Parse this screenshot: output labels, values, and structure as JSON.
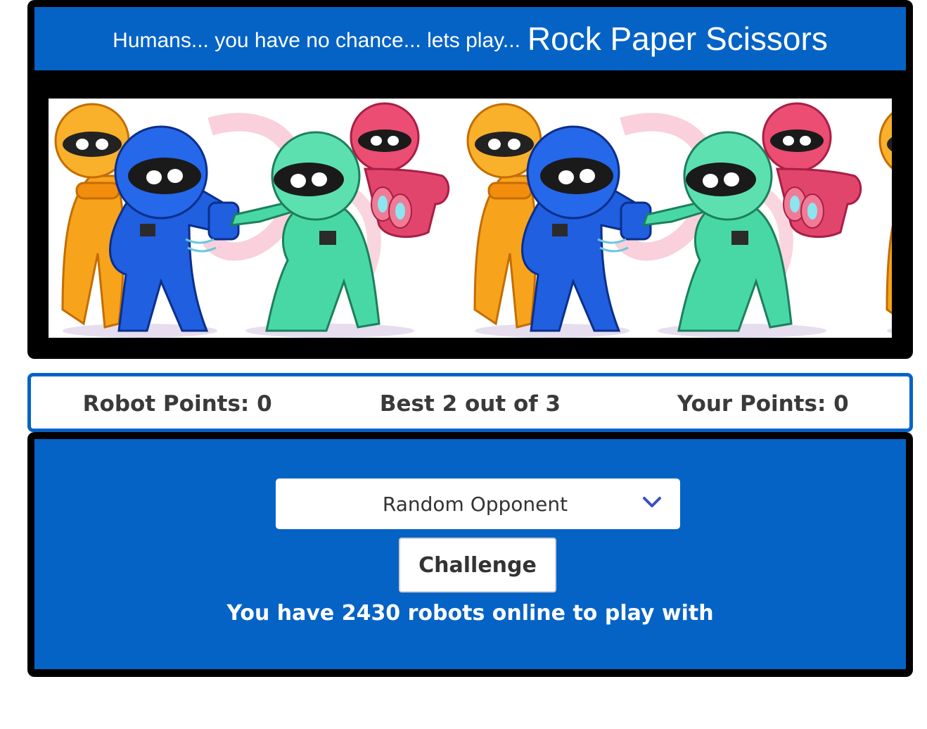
{
  "header": {
    "tagline": "Humans... you have no chance... lets play...",
    "title": "Rock Paper Scissors"
  },
  "banner": {
    "icon": "robots-banner-image"
  },
  "scoreboard": {
    "robot_points": "Robot Points: 0",
    "match_format": "Best 2 out of 3",
    "your_points": "Your Points: 0"
  },
  "controls": {
    "opponent_select": "Random Opponent",
    "challenge_label": "Challenge",
    "online_message": "You have 2430 robots online to play with"
  },
  "colors": {
    "primary_blue": "#0563c6",
    "frame": "#000000",
    "chevron": "#3b4fc4"
  }
}
